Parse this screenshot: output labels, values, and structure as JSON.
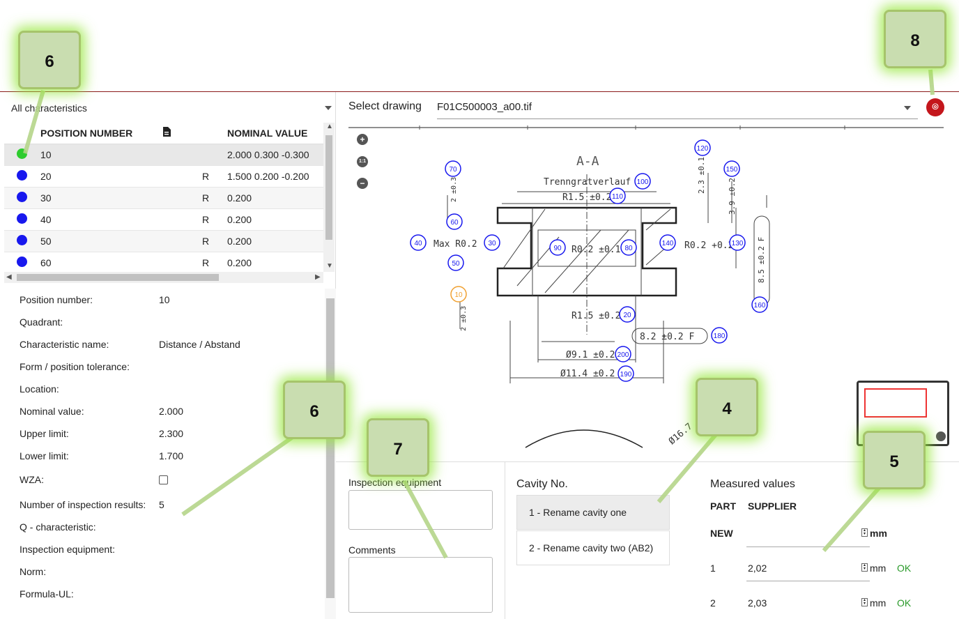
{
  "filter": {
    "label": "All characteristics"
  },
  "grid": {
    "headers": {
      "position": "POSITION NUMBER",
      "nominal": "NOMINAL VALUE"
    },
    "rows": [
      {
        "status": "green",
        "pos": "10",
        "r": "",
        "nominal": "2.000  0.300  -0.300"
      },
      {
        "status": "blue",
        "pos": "20",
        "r": "R",
        "nominal": "1.500  0.200  -0.200"
      },
      {
        "status": "blue",
        "pos": "30",
        "r": "R",
        "nominal": "0.200"
      },
      {
        "status": "blue",
        "pos": "40",
        "r": "R",
        "nominal": "0.200"
      },
      {
        "status": "blue",
        "pos": "50",
        "r": "R",
        "nominal": "0.200"
      },
      {
        "status": "blue",
        "pos": "60",
        "r": "R",
        "nominal": "0.200"
      }
    ]
  },
  "details": [
    {
      "label": "Position number:",
      "value": "10"
    },
    {
      "label": "Quadrant:",
      "value": ""
    },
    {
      "label": "Characteristic name:",
      "value": "Distance / Abstand"
    },
    {
      "label": "Form / position tolerance:",
      "value": ""
    },
    {
      "label": "Location:",
      "value": ""
    },
    {
      "label": "Nominal value:",
      "value": "2.000"
    },
    {
      "label": "Upper limit:",
      "value": "2.300"
    },
    {
      "label": "Lower limit:",
      "value": "1.700"
    },
    {
      "label": "WZA:",
      "value": ""
    },
    {
      "label": "Number of inspection results:",
      "value": "5"
    },
    {
      "label": "Q - characteristic:",
      "value": ""
    },
    {
      "label": "Inspection equipment:",
      "value": ""
    },
    {
      "label": "Norm:",
      "value": ""
    },
    {
      "label": "Formula-UL:",
      "value": ""
    }
  ],
  "drawing": {
    "select_label": "Select drawing",
    "file": "F01C500003_a00.tif",
    "section": "A-A",
    "note": "Trenngratverlauf",
    "dims": {
      "r15_top": "R1.5 ±0.2",
      "r15_bot": "R1.5 ±0.2",
      "max_r02": "Max R0.2",
      "r02_mid": "R0.2 ±0.1",
      "r02_right": "R0.2 +0.2",
      "d82": "8.2 ±0.2  F",
      "d91": "Ø9.1 ±0.2",
      "d114": "Ø11.4 ±0.2",
      "d167": "Ø16.7",
      "v23": "2.3 ±0.1",
      "v39": "3.9 ±0.2",
      "v85": "8.5 ±0.2  F",
      "v2a": "2 ±0.3",
      "v2b": "2 ±0.3"
    },
    "balloons": [
      "120",
      "150",
      "70",
      "100",
      "110",
      "60",
      "40",
      "30",
      "90",
      "80",
      "140",
      "130",
      "50",
      "10",
      "160",
      "20",
      "180",
      "200",
      "190"
    ]
  },
  "inspection": {
    "equipment_label": "Inspection equipment",
    "comments_label": "Comments"
  },
  "cavity": {
    "label": "Cavity No.",
    "items": [
      "1 - Rename cavity one",
      "2 - Rename cavity two (AB2)"
    ]
  },
  "measured": {
    "label": "Measured values",
    "col_part": "PART",
    "col_supplier": "SUPPLIER",
    "new_label": "NEW",
    "unit": "mm",
    "rows": [
      {
        "part": "1",
        "value": "2,02",
        "unit": "mm",
        "status": "OK"
      },
      {
        "part": "2",
        "value": "2,03",
        "unit": "mm",
        "status": "OK"
      }
    ]
  },
  "callouts": {
    "c6a": "6",
    "c6b": "6",
    "c7": "7",
    "c4": "4",
    "c5": "5",
    "c8": "8"
  },
  "colors": {
    "accent_line": "#8b1a1a",
    "balloon": "#1818ee",
    "balloon_sel": "#f0a030",
    "ok": "#2a9a2a",
    "clip": "#c4161c"
  }
}
